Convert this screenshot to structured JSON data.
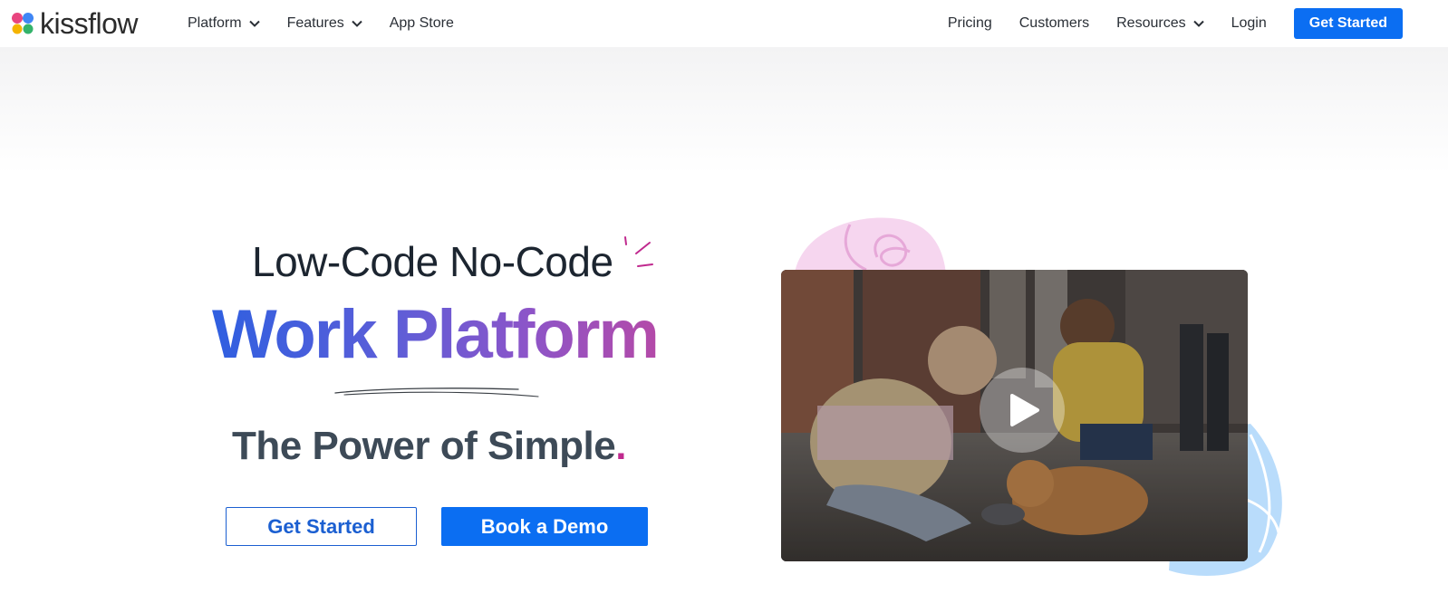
{
  "brand": {
    "name": "kissflow"
  },
  "nav": {
    "left": [
      {
        "label": "Platform",
        "dropdown": true
      },
      {
        "label": "Features",
        "dropdown": true
      },
      {
        "label": "App Store",
        "dropdown": false
      }
    ],
    "right": [
      {
        "label": "Pricing",
        "dropdown": false
      },
      {
        "label": "Customers",
        "dropdown": false
      },
      {
        "label": "Resources",
        "dropdown": true
      },
      {
        "label": "Login",
        "dropdown": false
      }
    ],
    "cta": "Get Started"
  },
  "hero": {
    "line1": "Low-Code No-Code",
    "line2": "Work Platform",
    "line3": "The Power of Simple",
    "line3_dot": ".",
    "primary_button": "Book a Demo",
    "secondary_button": "Get Started"
  },
  "colors": {
    "accent": "#0b6ef2",
    "gradient_start": "#2f5fe0",
    "gradient_end": "#b44aa8",
    "dot": "#c0298e"
  },
  "icons": {
    "logo": "butterfly-logo-icon",
    "dropdown": "chevron-down-icon",
    "video": "play-icon"
  }
}
